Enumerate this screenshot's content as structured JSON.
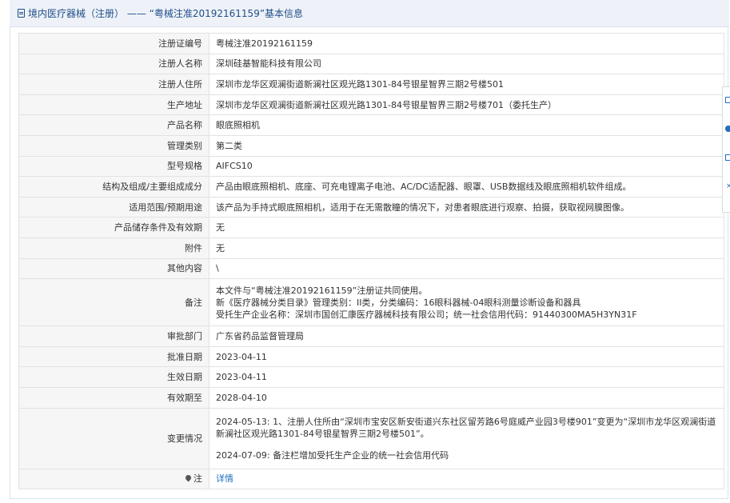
{
  "header": {
    "title": "境内医疗器械（注册） —— “粤械注准20192161159”基本信息"
  },
  "rows": [
    {
      "label": "注册证编号",
      "value": "粤械注准20192161159"
    },
    {
      "label": "注册人名称",
      "value": "深圳硅基智能科技有限公司"
    },
    {
      "label": "注册人住所",
      "value": "深圳市龙华区观澜街道新澜社区观光路1301-84号银星智界三期2号楼501"
    },
    {
      "label": "生产地址",
      "value": "深圳市龙华区观澜街道新澜社区观光路1301-84号银星智界三期2号楼701（委托生产）"
    },
    {
      "label": "产品名称",
      "value": "眼底照相机"
    },
    {
      "label": "管理类别",
      "value": "第二类"
    },
    {
      "label": "型号规格",
      "value": "AIFCS10"
    },
    {
      "label": "结构及组成/主要组成成分",
      "value": "产品由眼底照相机、底座、可充电锂离子电池、AC/DC适配器、眼罩、USB数据线及眼底照相机软件组成。"
    },
    {
      "label": "适用范围/预期用途",
      "value": "该产品为手持式眼底照相机，适用于在无需散瞳的情况下，对患者眼底进行观察、拍摄，获取视网膜图像。"
    },
    {
      "label": "产品储存条件及有效期",
      "value": "无"
    },
    {
      "label": "附件",
      "value": "无"
    },
    {
      "label": "其他内容",
      "value": "\\"
    }
  ],
  "note": {
    "label": "备注",
    "lines": [
      "本文件与“粤械注准20192161159”注册证共同使用。",
      "新《医疗器械分类目录》管理类别：II类，分类编码：16眼科器械-04眼科测量诊断设备和器具",
      "受托生产企业名称：深圳市国创汇康医疗器械科技有限公司；统一社会信用代码：91440300MA5H3YN31F"
    ]
  },
  "rows2": [
    {
      "label": "审批部门",
      "value": "广东省药品监督管理局"
    },
    {
      "label": "批准日期",
      "value": "2023-04-11"
    },
    {
      "label": "生效日期",
      "value": "2023-04-11"
    },
    {
      "label": "有效期至",
      "value": "2028-04-10"
    }
  ],
  "change": {
    "label": "变更情况",
    "line1": "2024-05-13: 1、注册人住所由“深圳市宝安区新安街道兴东社区留芳路6号庭威产业园3号楼901”变更为“深圳市龙华区观澜街道新澜社区观光路1301-84号银星智界三期2号楼501”。",
    "line2": "2024-07-09: 备注栏增加受托生产企业的统一社会信用代码"
  },
  "footer_row": {
    "label": "注",
    "link": "详情"
  },
  "colors": {
    "accent": "#1e6fbd",
    "header_bg": "#eef2f8",
    "label_bg": "#f6f6f6",
    "border": "#e2e2e2"
  }
}
